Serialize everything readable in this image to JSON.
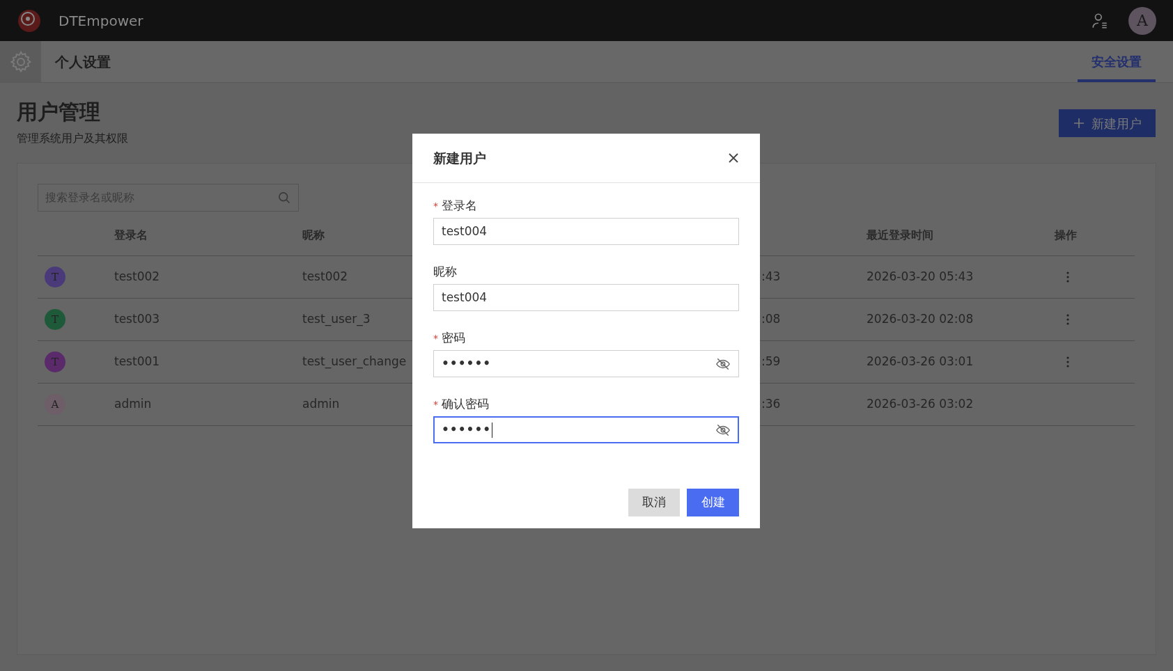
{
  "app_bar": {
    "brand": "DTEmpower",
    "avatar": "A"
  },
  "sub_bar": {
    "title": "个人设置",
    "tabs": [
      {
        "label": "安全设置",
        "selected": true
      }
    ]
  },
  "page": {
    "title": "用户管理",
    "subtitle": "管理系统用户及其权限",
    "new_button": "新建用户"
  },
  "search": {
    "placeholder": "搜索登录名或昵称"
  },
  "table": {
    "columns": [
      "登录名",
      "昵称",
      "最近登录时间",
      "操作"
    ],
    "rows": [
      {
        "avatar": "T",
        "color": "#4b3a7a",
        "login": "test002",
        "nickname": "test002",
        "column_3": ":43",
        "last_login": "2026-03-20 05:43",
        "has_actions": true
      },
      {
        "avatar": "T",
        "color": "#1e5a3a",
        "login": "test003",
        "nickname": "test_user_3",
        "column_3": ":08",
        "last_login": "2026-03-20 02:08",
        "has_actions": true
      },
      {
        "avatar": "T",
        "color": "#5a2a6a",
        "login": "test001",
        "nickname": "test_user_change",
        "column_3": ":59",
        "last_login": "2026-03-26 03:01",
        "has_actions": true
      },
      {
        "avatar": "A",
        "color": "#6e5e68",
        "login": "admin",
        "nickname": "admin",
        "column_3": ":36",
        "last_login": "2026-03-26 03:02",
        "has_actions": false
      }
    ]
  },
  "dialog": {
    "title": "新建用户",
    "fields": [
      {
        "label": "登录名",
        "marker": "*",
        "value": "test004",
        "kind": "text",
        "focused": false
      },
      {
        "label": "昵称",
        "value": "test004",
        "kind": "text",
        "focused": false
      },
      {
        "label": "密码",
        "marker": "*",
        "value": "••••••",
        "kind": "password",
        "focused": false
      },
      {
        "label": "确认密码",
        "marker": "*",
        "value": "••••••",
        "kind": "password",
        "focused": true
      }
    ],
    "cancel": "取消",
    "confirm": "创建"
  }
}
